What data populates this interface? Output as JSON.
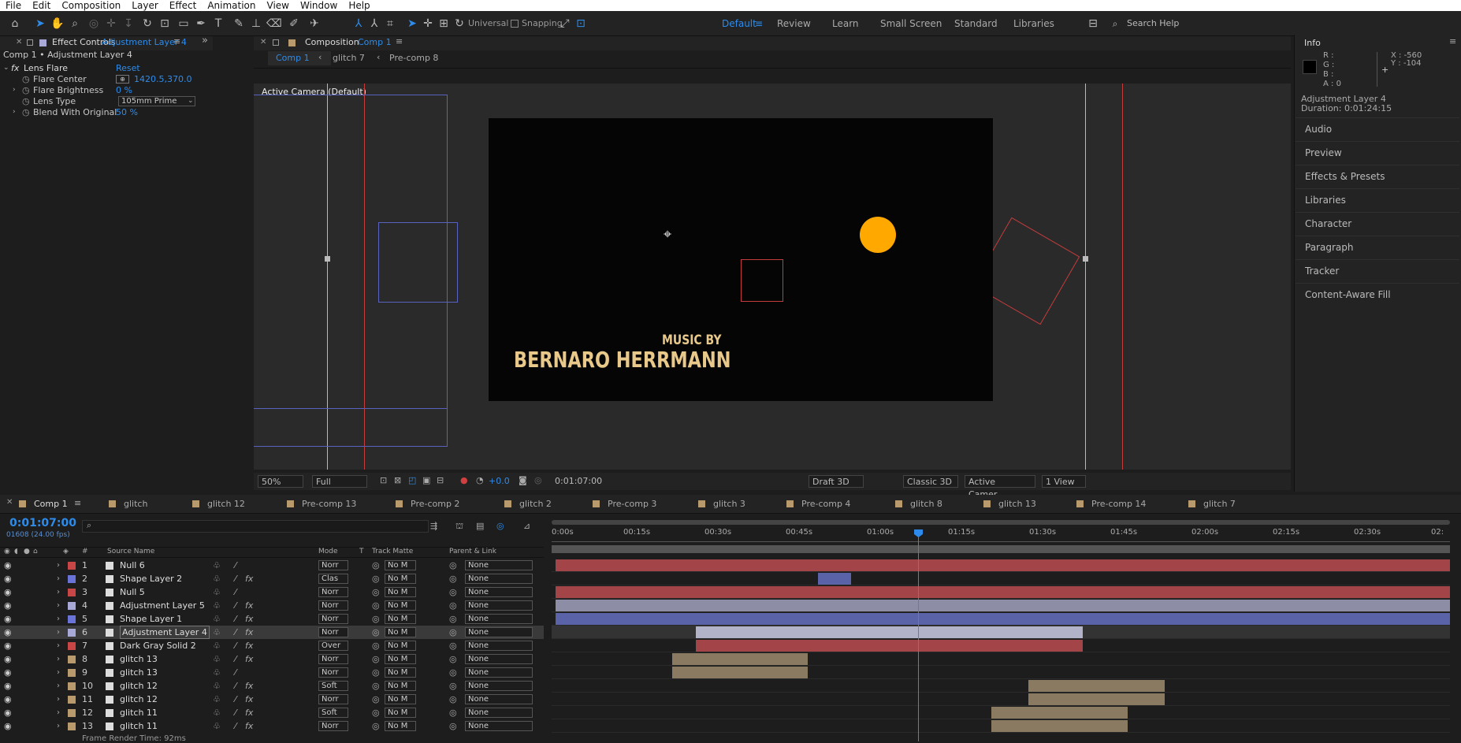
{
  "menu": [
    "File",
    "Edit",
    "Composition",
    "Layer",
    "Effect",
    "Animation",
    "View",
    "Window",
    "Help"
  ],
  "toolbar": {
    "axis_mode": "Universal",
    "snapping": "Snapping",
    "workspaces": [
      "Default",
      "Review",
      "Learn",
      "Small Screen",
      "Standard",
      "Libraries"
    ],
    "search_placeholder": "Search Help"
  },
  "effect_controls": {
    "tab_label": "Effect Controls",
    "tab_layer": "Adjustment Layer 4",
    "breadcrumb": "Comp 1 • Adjustment Layer 4",
    "effect_name": "Lens Flare",
    "reset": "Reset",
    "props": [
      {
        "label": "Flare Center",
        "value": "1420.5,370.0"
      },
      {
        "label": "Flare Brightness",
        "value": "0 %"
      },
      {
        "label": "Lens Type",
        "value": "105mm Prime"
      },
      {
        "label": "Blend With Original",
        "value": "50 %"
      }
    ]
  },
  "composition": {
    "tab_label": "Composition",
    "tab_comp": "Comp 1",
    "nav": [
      "Comp 1",
      "glitch 7",
      "Pre-comp 8"
    ],
    "camera_label": "Active Camera (Default)",
    "title_small": "MUSIC BY",
    "title_big": "BERNARO HERRMANN",
    "bottom": {
      "zoom": "50%",
      "resolution": "Full",
      "exposure": "+0.0",
      "timecode": "0:01:07:00",
      "draft": "Draft 3D",
      "renderer": "Classic 3D",
      "camera": "Active Camer...",
      "views": "1 View"
    }
  },
  "info": {
    "title": "Info",
    "r": "R :",
    "g": "G :",
    "b": "B :",
    "a": "A : 0",
    "x": "X : -560",
    "y": "Y : -104",
    "layer_name": "Adjustment Layer 4",
    "duration": "Duration: 0:01:24:15",
    "panels": [
      "Audio",
      "Preview",
      "Effects & Presets",
      "Libraries",
      "Character",
      "Paragraph",
      "Tracker",
      "Content-Aware Fill"
    ]
  },
  "timeline": {
    "tabs": [
      "Comp 1",
      "glitch",
      "glitch 12",
      "Pre-comp 13",
      "Pre-comp 2",
      "glitch 2",
      "Pre-comp 3",
      "glitch 3",
      "Pre-comp 4",
      "glitch 8",
      "glitch 13",
      "Pre-comp 14",
      "glitch 7"
    ],
    "timecode": "0:01:07:00",
    "frames": "01608 (24.00 fps)",
    "headers": {
      "source": "Source Name",
      "mode": "Mode",
      "t": "T",
      "matte": "Track Matte",
      "parent": "Parent & Link",
      "num": "#"
    },
    "ruler": [
      "0:00s",
      "00:15s",
      "00:30s",
      "00:45s",
      "01:00s",
      "01:15s",
      "01:30s",
      "01:45s",
      "02:00s",
      "02:15s",
      "02:30s",
      "02:"
    ],
    "layers": [
      {
        "n": "1",
        "name": "Null 6",
        "color": "#c84646",
        "mode": "Norr",
        "matte": "No M",
        "parent": "None"
      },
      {
        "n": "2",
        "name": "Shape Layer 2",
        "color": "#6a74d8",
        "mode": "Clas",
        "matte": "No M",
        "parent": "None"
      },
      {
        "n": "3",
        "name": "Null 5",
        "color": "#c84646",
        "mode": "Norr",
        "matte": "No M",
        "parent": "None"
      },
      {
        "n": "4",
        "name": "Adjustment Layer 5",
        "color": "#a9a9d8",
        "mode": "Norr",
        "matte": "No M",
        "parent": "None"
      },
      {
        "n": "5",
        "name": "Shape Layer 1",
        "color": "#6a74d8",
        "mode": "Norr",
        "matte": "No M",
        "parent": "None"
      },
      {
        "n": "6",
        "name": "Adjustment Layer 4",
        "color": "#a9a9d8",
        "mode": "Norr",
        "matte": "No M",
        "parent": "None"
      },
      {
        "n": "7",
        "name": "Dark Gray Solid 2",
        "color": "#c84646",
        "mode": "Over",
        "matte": "No M",
        "parent": "None"
      },
      {
        "n": "8",
        "name": "glitch 13",
        "color": "#b89a6c",
        "mode": "Norr",
        "matte": "No M",
        "parent": "None"
      },
      {
        "n": "9",
        "name": "glitch 13",
        "color": "#b89a6c",
        "mode": "Norr",
        "matte": "No M",
        "parent": "None"
      },
      {
        "n": "10",
        "name": "glitch 12",
        "color": "#b89a6c",
        "mode": "Soft",
        "matte": "No M",
        "parent": "None"
      },
      {
        "n": "11",
        "name": "glitch 12",
        "color": "#b89a6c",
        "mode": "Norr",
        "matte": "No M",
        "parent": "None"
      },
      {
        "n": "12",
        "name": "glitch 11",
        "color": "#b89a6c",
        "mode": "Soft",
        "matte": "No M",
        "parent": "None"
      },
      {
        "n": "13",
        "name": "glitch 11",
        "color": "#b89a6c",
        "mode": "Norr",
        "matte": "No M",
        "parent": "None"
      }
    ],
    "footer": "Frame Render Time: 92ms"
  },
  "colors": {
    "accent": "#2d8ceb",
    "title_text": "#e9c98a",
    "sun": "#ffa800"
  }
}
